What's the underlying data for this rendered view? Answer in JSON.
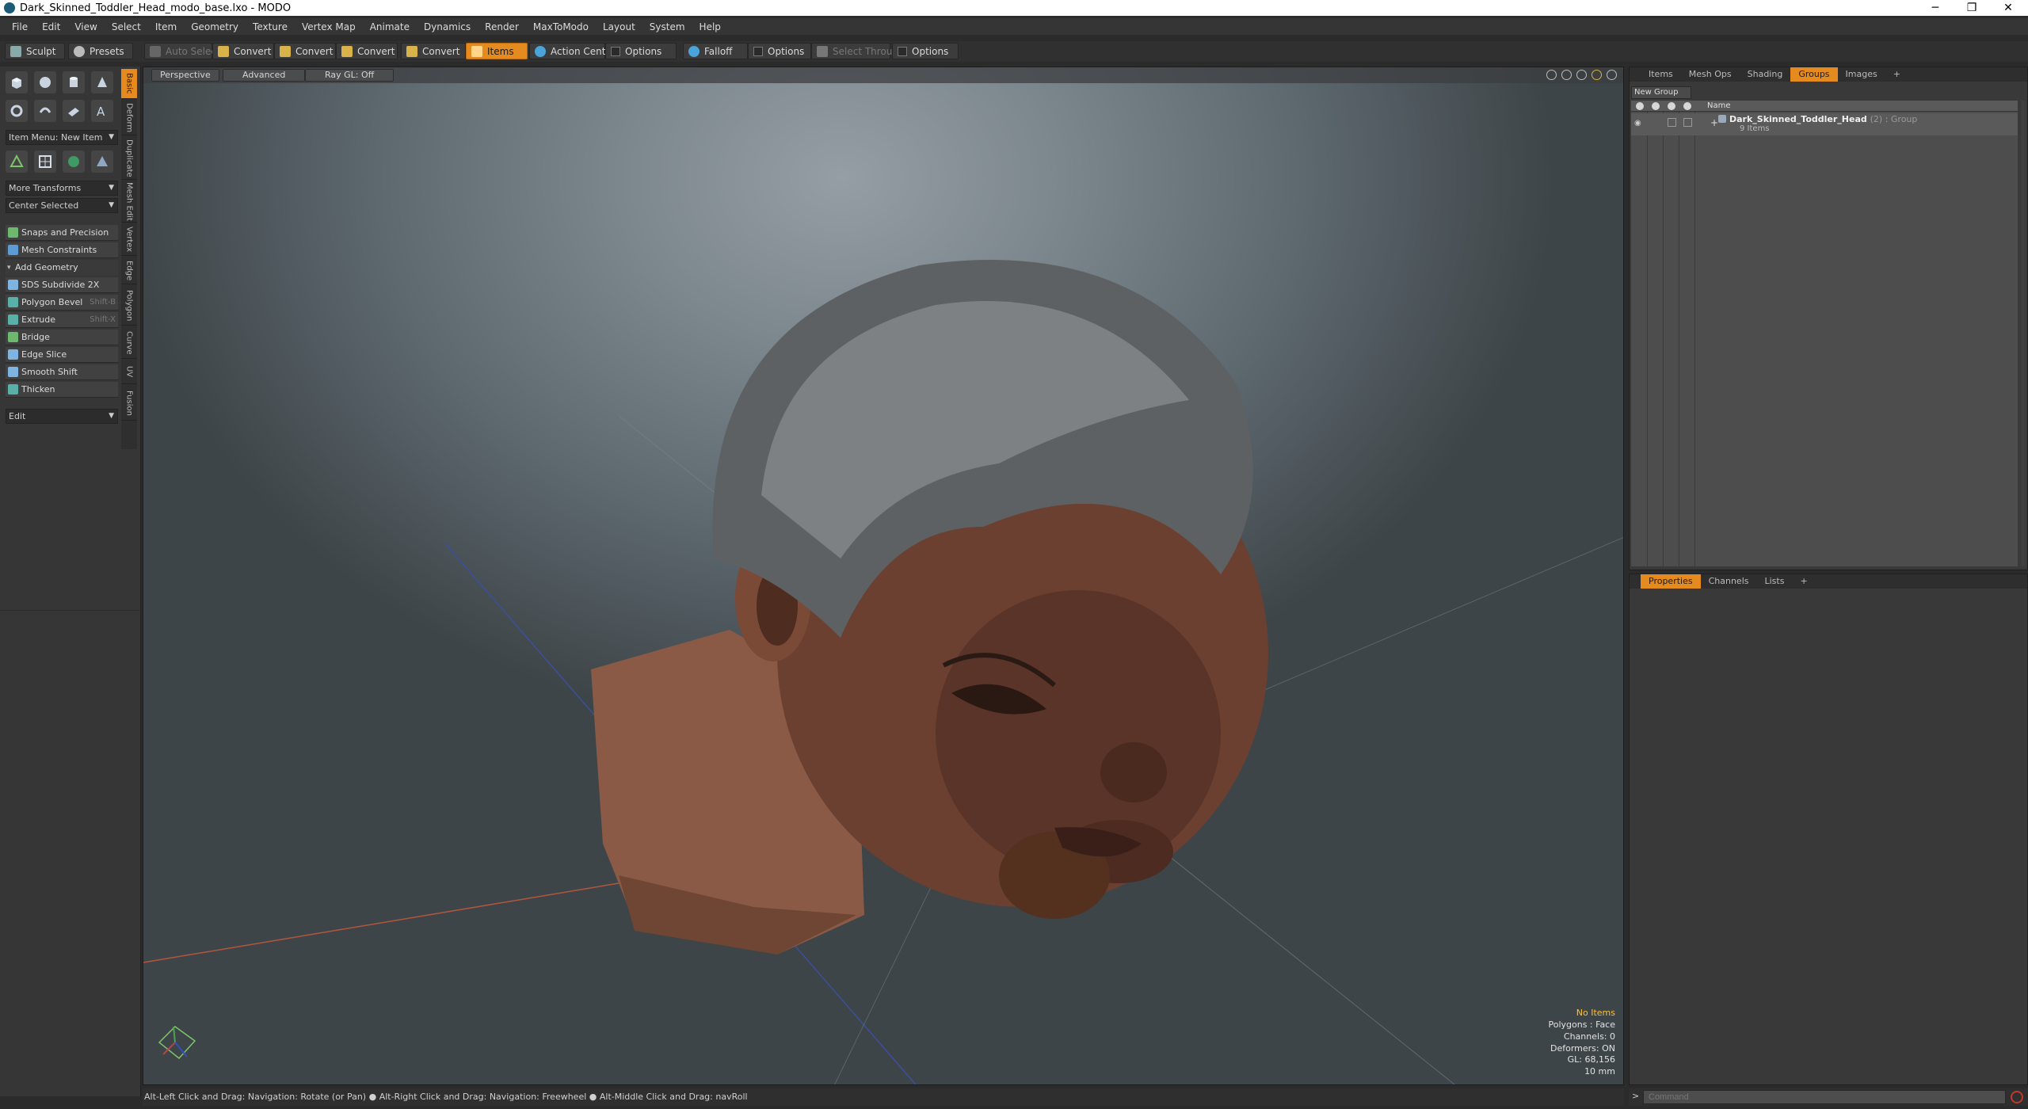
{
  "window": {
    "title": "Dark_Skinned_Toddler_Head_modo_base.lxo - MODO",
    "minimize": "─",
    "maximize": "❐",
    "close": "✕"
  },
  "menu": [
    "File",
    "Edit",
    "View",
    "Select",
    "Item",
    "Geometry",
    "Texture",
    "Vertex Map",
    "Animate",
    "Dynamics",
    "Render",
    "MaxToModo",
    "Layout",
    "System",
    "Help"
  ],
  "toolbar": {
    "sculpt": "Sculpt",
    "presets": "Presets",
    "auto_select": "Auto Select",
    "convert1": "Convert",
    "convert2": "Convert",
    "convert3": "Convert",
    "convert4": "Convert",
    "items": "Items",
    "action_center": "Action Center",
    "options1": "Options",
    "falloff": "Falloff",
    "options2": "Options",
    "select_through": "Select Through",
    "options3": "Options"
  },
  "left_panel": {
    "side_tabs": [
      "Basic",
      "Deform",
      "Duplicate",
      "Mesh Edit",
      "Vertex",
      "Edge",
      "Polygon",
      "Curve",
      "UV",
      "Fusion"
    ],
    "item_menu": "Item Menu: New Item",
    "more_transforms": "More Transforms",
    "center_selected": "Center Selected",
    "snaps": "Snaps and Precision",
    "mesh_constraints": "Mesh Constraints",
    "add_geometry": "Add Geometry",
    "tools": [
      {
        "label": "SDS Subdivide 2X",
        "shortcut": ""
      },
      {
        "label": "Polygon Bevel",
        "shortcut": "Shift-B"
      },
      {
        "label": "Extrude",
        "shortcut": "Shift-X"
      },
      {
        "label": "Bridge",
        "shortcut": ""
      },
      {
        "label": "Edge Slice",
        "shortcut": ""
      },
      {
        "label": "Smooth Shift",
        "shortcut": ""
      },
      {
        "label": "Thicken",
        "shortcut": ""
      }
    ],
    "edit": "Edit"
  },
  "viewport": {
    "view_mode": "Perspective",
    "advanced": "Advanced",
    "raygl": "Ray GL: Off",
    "hud": {
      "items": "No Items",
      "polygons": "Polygons : Face",
      "channels": "Channels: 0",
      "deformers": "Deformers: ON",
      "gl": "GL: 68,156",
      "scale": "10 mm"
    }
  },
  "status": "Alt-Left Click and Drag: Navigation: Rotate (or Pan) ● Alt-Right Click and Drag: Navigation: Freewheel ● Alt-Middle Click and Drag: navRoll",
  "command": {
    "prompt": ">",
    "placeholder": "Command"
  },
  "right_top": {
    "tabs": [
      "Items",
      "Mesh Ops",
      "Shading",
      "Groups",
      "Images"
    ],
    "add_tab": "+",
    "new_group": "New Group",
    "col_name": "Name",
    "group_name": "Dark_Skinned_Toddler_Head",
    "group_meta": "(2) : Group",
    "group_sub": "9 Items",
    "expand": "+"
  },
  "right_bottom": {
    "tabs": [
      "Properties",
      "Channels",
      "Lists"
    ],
    "add_tab": "+"
  },
  "colors": {
    "accent": "#e58a1e",
    "hud_highlight": "#ffc233"
  }
}
